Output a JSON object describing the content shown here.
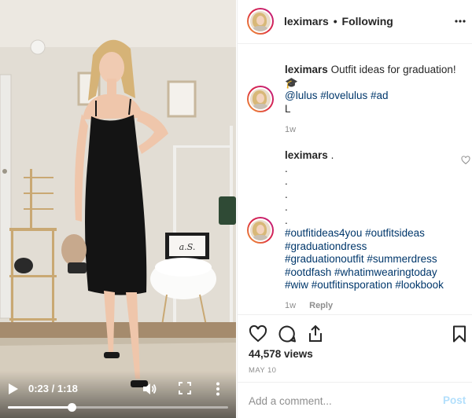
{
  "video": {
    "time_display": "0:23 / 1:18",
    "progress_fraction": 0.29,
    "sign_text": "a.S."
  },
  "header": {
    "username": "leximars",
    "separator": "•",
    "follow_status": "Following"
  },
  "comments": [
    {
      "username": "leximars",
      "text": "Outfit ideas for graduation!🎓",
      "mentions_line": "@lulus #lovelulus #ad"
    },
    {
      "text": "L",
      "age": "1w"
    },
    {
      "username": "leximars",
      "text": ".",
      "dots": [
        ".",
        ".",
        ".",
        ".",
        "."
      ]
    },
    {
      "hashtags": [
        "#outfitideas4you #outfitsideas",
        "#graduationdress",
        "#graduationoutfit #summerdress",
        "#ootdfash #whatimwearingtoday",
        "#wiw #outfitinsporation #lookbook"
      ],
      "age": "1w",
      "reply_label": "Reply"
    }
  ],
  "stats": {
    "views": "44,578 views",
    "date": "MAY 10"
  },
  "comment_box": {
    "placeholder": "Add a comment...",
    "post_label": "Post"
  },
  "colors": {
    "link": "#00376b",
    "muted": "#8e8e8e",
    "post_disabled": "#b2dffc",
    "border": "#efefef"
  },
  "icons": [
    "play-icon",
    "volume-icon",
    "fullscreen-icon",
    "more-vertical-icon",
    "more-horizontal-icon",
    "heart-icon",
    "comment-icon",
    "share-icon",
    "bookmark-icon"
  ]
}
